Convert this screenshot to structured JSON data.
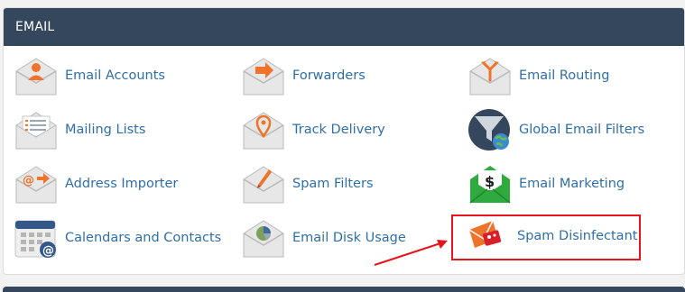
{
  "panel": {
    "title": "EMAIL"
  },
  "items": [
    {
      "label": "Email Accounts",
      "icon": "email-accounts-icon"
    },
    {
      "label": "Forwarders",
      "icon": "forwarders-icon"
    },
    {
      "label": "Email Routing",
      "icon": "email-routing-icon"
    },
    {
      "label": "Mailing Lists",
      "icon": "mailing-lists-icon"
    },
    {
      "label": "Track Delivery",
      "icon": "track-delivery-icon"
    },
    {
      "label": "Global Email Filters",
      "icon": "global-email-filters-icon"
    },
    {
      "label": "Address Importer",
      "icon": "address-importer-icon"
    },
    {
      "label": "Spam Filters",
      "icon": "spam-filters-icon"
    },
    {
      "label": "Email Marketing",
      "icon": "email-marketing-icon"
    },
    {
      "label": "Calendars and Contacts",
      "icon": "calendars-contacts-icon"
    },
    {
      "label": "Email Disk Usage",
      "icon": "email-disk-usage-icon"
    },
    {
      "label": "Spam Disinfectant",
      "icon": "spam-disinfectant-icon"
    }
  ],
  "colors": {
    "header_bg": "#35475c",
    "link": "#2f6fa7",
    "accent_orange": "#f0732b",
    "highlight_red": "#e8141b",
    "marketing_green": "#2eaa3f"
  }
}
